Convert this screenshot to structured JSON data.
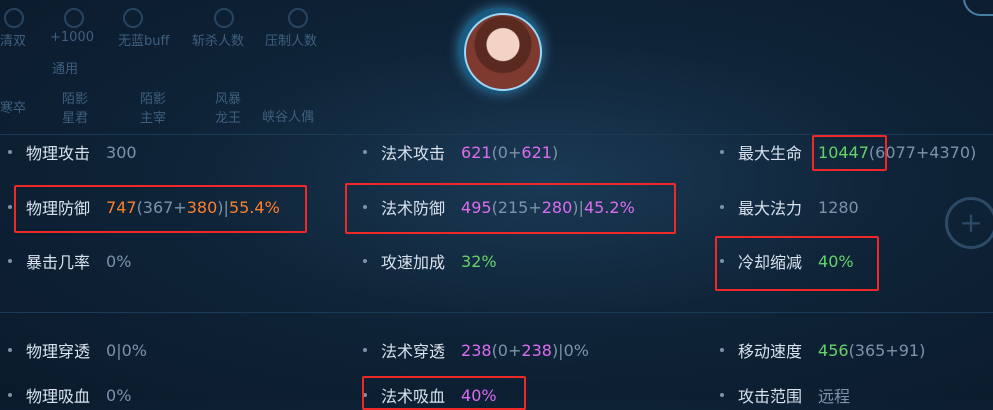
{
  "background_faded": {
    "row1": [
      "清双",
      "+1000",
      "无蓝buff",
      "斩杀人数",
      "压制人数"
    ],
    "row1_sub": "通用",
    "row2": [
      "寒卒",
      "陌影\n星君",
      "陌影\n主宰",
      "风暴\n龙王",
      "峡谷人偶"
    ]
  },
  "stats": [
    {
      "label": "物理攻击",
      "parts": [
        {
          "text": "300",
          "color": "blue"
        }
      ]
    },
    {
      "label": "法术攻击",
      "parts": [
        {
          "text": "621",
          "color": "purple"
        },
        {
          "text": "(0+",
          "color": "gray"
        },
        {
          "text": "621",
          "color": "purple"
        },
        {
          "text": ")",
          "color": "gray"
        }
      ]
    },
    {
      "label": "最大生命",
      "parts": [
        {
          "text": "10447",
          "color": "green"
        },
        {
          "text": "(6077+4370)",
          "color": "gray"
        }
      ]
    },
    {
      "label": "物理防御",
      "parts": [
        {
          "text": "747",
          "color": "orange"
        },
        {
          "text": "(367+",
          "color": "gray"
        },
        {
          "text": "380",
          "color": "orange"
        },
        {
          "text": ")|",
          "color": "gray"
        },
        {
          "text": "55.4%",
          "color": "orange"
        }
      ]
    },
    {
      "label": "法术防御",
      "parts": [
        {
          "text": "495",
          "color": "purple"
        },
        {
          "text": "(215+",
          "color": "gray"
        },
        {
          "text": "280",
          "color": "purple"
        },
        {
          "text": ")|",
          "color": "gray"
        },
        {
          "text": "45.2%",
          "color": "purple"
        }
      ]
    },
    {
      "label": "最大法力",
      "parts": [
        {
          "text": "1280",
          "color": "blue"
        }
      ]
    },
    {
      "label": "暴击几率",
      "parts": [
        {
          "text": "0%",
          "color": "blue"
        }
      ]
    },
    {
      "label": "攻速加成",
      "parts": [
        {
          "text": "32%",
          "color": "green"
        }
      ]
    },
    {
      "label": "冷却缩减",
      "parts": [
        {
          "text": "40%",
          "color": "green"
        }
      ]
    },
    {
      "label": "物理穿透",
      "parts": [
        {
          "text": "0|0%",
          "color": "blue"
        }
      ]
    },
    {
      "label": "法术穿透",
      "parts": [
        {
          "text": "238",
          "color": "purple"
        },
        {
          "text": "(0+",
          "color": "gray"
        },
        {
          "text": "238",
          "color": "purple"
        },
        {
          "text": ")|0%",
          "color": "gray"
        }
      ]
    },
    {
      "label": "移动速度",
      "parts": [
        {
          "text": "456",
          "color": "green"
        },
        {
          "text": "(365+91)",
          "color": "gray"
        }
      ]
    },
    {
      "label": "物理吸血",
      "parts": [
        {
          "text": "0%",
          "color": "blue"
        }
      ]
    },
    {
      "label": "法术吸血",
      "parts": [
        {
          "text": "40%",
          "color": "purple"
        }
      ]
    },
    {
      "label": "攻击范围",
      "parts": [
        {
          "text": "远程",
          "color": "blue"
        }
      ]
    }
  ],
  "colors": {
    "blue": "#7c93aa",
    "gray": "#7c93aa",
    "orange": "#ff7f2a",
    "purple": "#dc6cf1",
    "green": "#65d36c",
    "highlight": "#f02828"
  },
  "icons": [
    "hero-avatar-icon",
    "plus-circle-icon"
  ]
}
